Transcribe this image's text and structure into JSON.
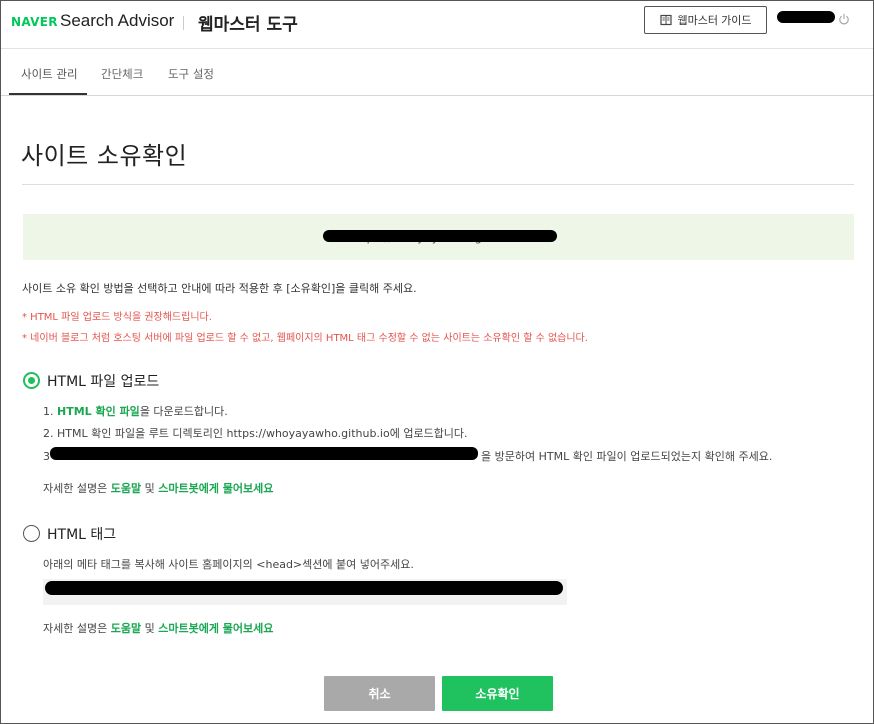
{
  "header": {
    "logo": "NAVER",
    "product": "Search Advisor",
    "section": "웹마스터 도구",
    "guide_button": "웹마스터 가이드"
  },
  "tabs": [
    {
      "label": "사이트 관리",
      "active": true
    },
    {
      "label": "간단체크",
      "active": false
    },
    {
      "label": "도구 설정",
      "active": false
    }
  ],
  "page": {
    "title": "사이트 소유확인",
    "site_url": "https://whoyayawho.github.io",
    "intro": "사이트 소유 확인 방법을 선택하고 안내에 따라 적용한 후 [소유확인]을 클릭해 주세요.",
    "warnings": [
      "* HTML 파일 업로드 방식을 권장해드립니다.",
      "* 네이버 블로그 처럼 호스팅 서버에 파일 업로드 할 수 없고, 웹페이지의 HTML 태그 수정할 수 없는 사이트는 소유확인 할 수 없습니다."
    ]
  },
  "option_html_file": {
    "label": "HTML 파일 업로드",
    "selected": true,
    "step1_prefix": "1. ",
    "step1_link": "HTML 확인 파일",
    "step1_suffix": "을 다운로드합니다.",
    "step2": "2. HTML 확인 파일을 루트 디렉토리인 https://whoyayawho.github.io에 업로드합니다.",
    "step3_prefix": "3",
    "step3_suffix": "을 방문하여 HTML 확인 파일이 업로드되었는지 확인해 주세요.",
    "help_prefix": "자세한 설명은 ",
    "help_link1": "도움말",
    "help_mid": " 및 ",
    "help_link2": "스마트봇에게 물어보세요"
  },
  "option_html_tag": {
    "label": "HTML 태그",
    "selected": false,
    "description": "아래의 메타 태그를 복사해 사이트 홈페이지의 <head>섹션에 붙여 넣어주세요.",
    "help_prefix": "자세한 설명은 ",
    "help_link1": "도움말",
    "help_mid": " 및 ",
    "help_link2": "스마트봇에게 물어보세요"
  },
  "buttons": {
    "cancel": "취소",
    "confirm": "소유확인"
  },
  "colors": {
    "brand_green": "#03c75a",
    "accent_green": "#1fc25f",
    "warning_red": "#e5534b",
    "url_box_bg": "#eef6e8"
  }
}
